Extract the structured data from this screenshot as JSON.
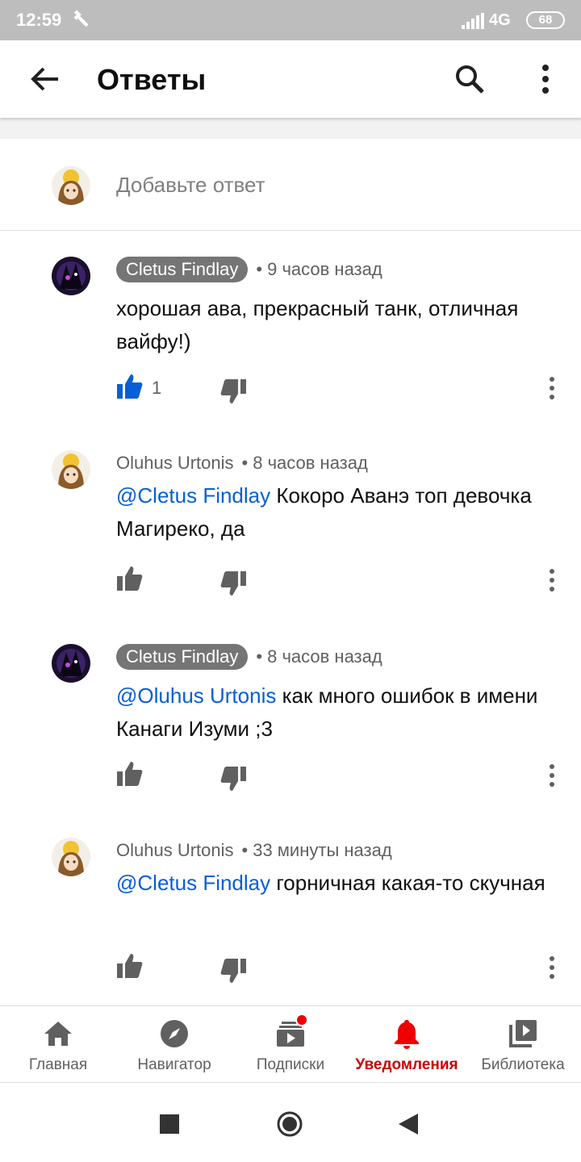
{
  "status_bar": {
    "time": "12:59",
    "network": "4G",
    "battery": "68"
  },
  "header": {
    "title": "Ответы",
    "back_icon": "arrow-left-icon",
    "search_icon": "search-icon",
    "menu_icon": "more-vert-icon"
  },
  "compose": {
    "placeholder": "Добавьте ответ"
  },
  "comments": [
    {
      "author": "Cletus Findlay",
      "time": "9 часов назад",
      "mention": "",
      "text": "хорошая ава, прекрасный танк, отличная вайфу!)",
      "likes": "1",
      "liked": true
    },
    {
      "author": "Oluhus Urtonis",
      "time": "8 часов назад",
      "mention": "@Cletus Findlay",
      "text": " Кокоро Аванэ топ девочка Магиреко, да",
      "likes": "",
      "liked": false
    },
    {
      "author": "Cletus Findlay",
      "time": "8 часов назад",
      "mention": "@Oluhus Urtonis",
      "text": " как много ошибок в имени Канаги Изуми ;3",
      "likes": "",
      "liked": false
    },
    {
      "author": "Oluhus Urtonis",
      "time": "33 минуты назад",
      "mention": "@Cletus Findlay",
      "text": " горничная какая-то скучная",
      "likes": "",
      "liked": false
    }
  ],
  "bottom_nav": [
    {
      "label": "Главная",
      "icon": "home-icon"
    },
    {
      "label": "Навигатор",
      "icon": "compass-icon"
    },
    {
      "label": "Подписки",
      "icon": "subscriptions-icon"
    },
    {
      "label": "Уведомления",
      "icon": "bell-icon",
      "active": true
    },
    {
      "label": "Библиотека",
      "icon": "library-icon"
    }
  ],
  "colors": {
    "accent_red": "#cc0000",
    "link_blue": "#065fd4",
    "like_blue": "#065fd4",
    "chip_gray": "#757575"
  }
}
